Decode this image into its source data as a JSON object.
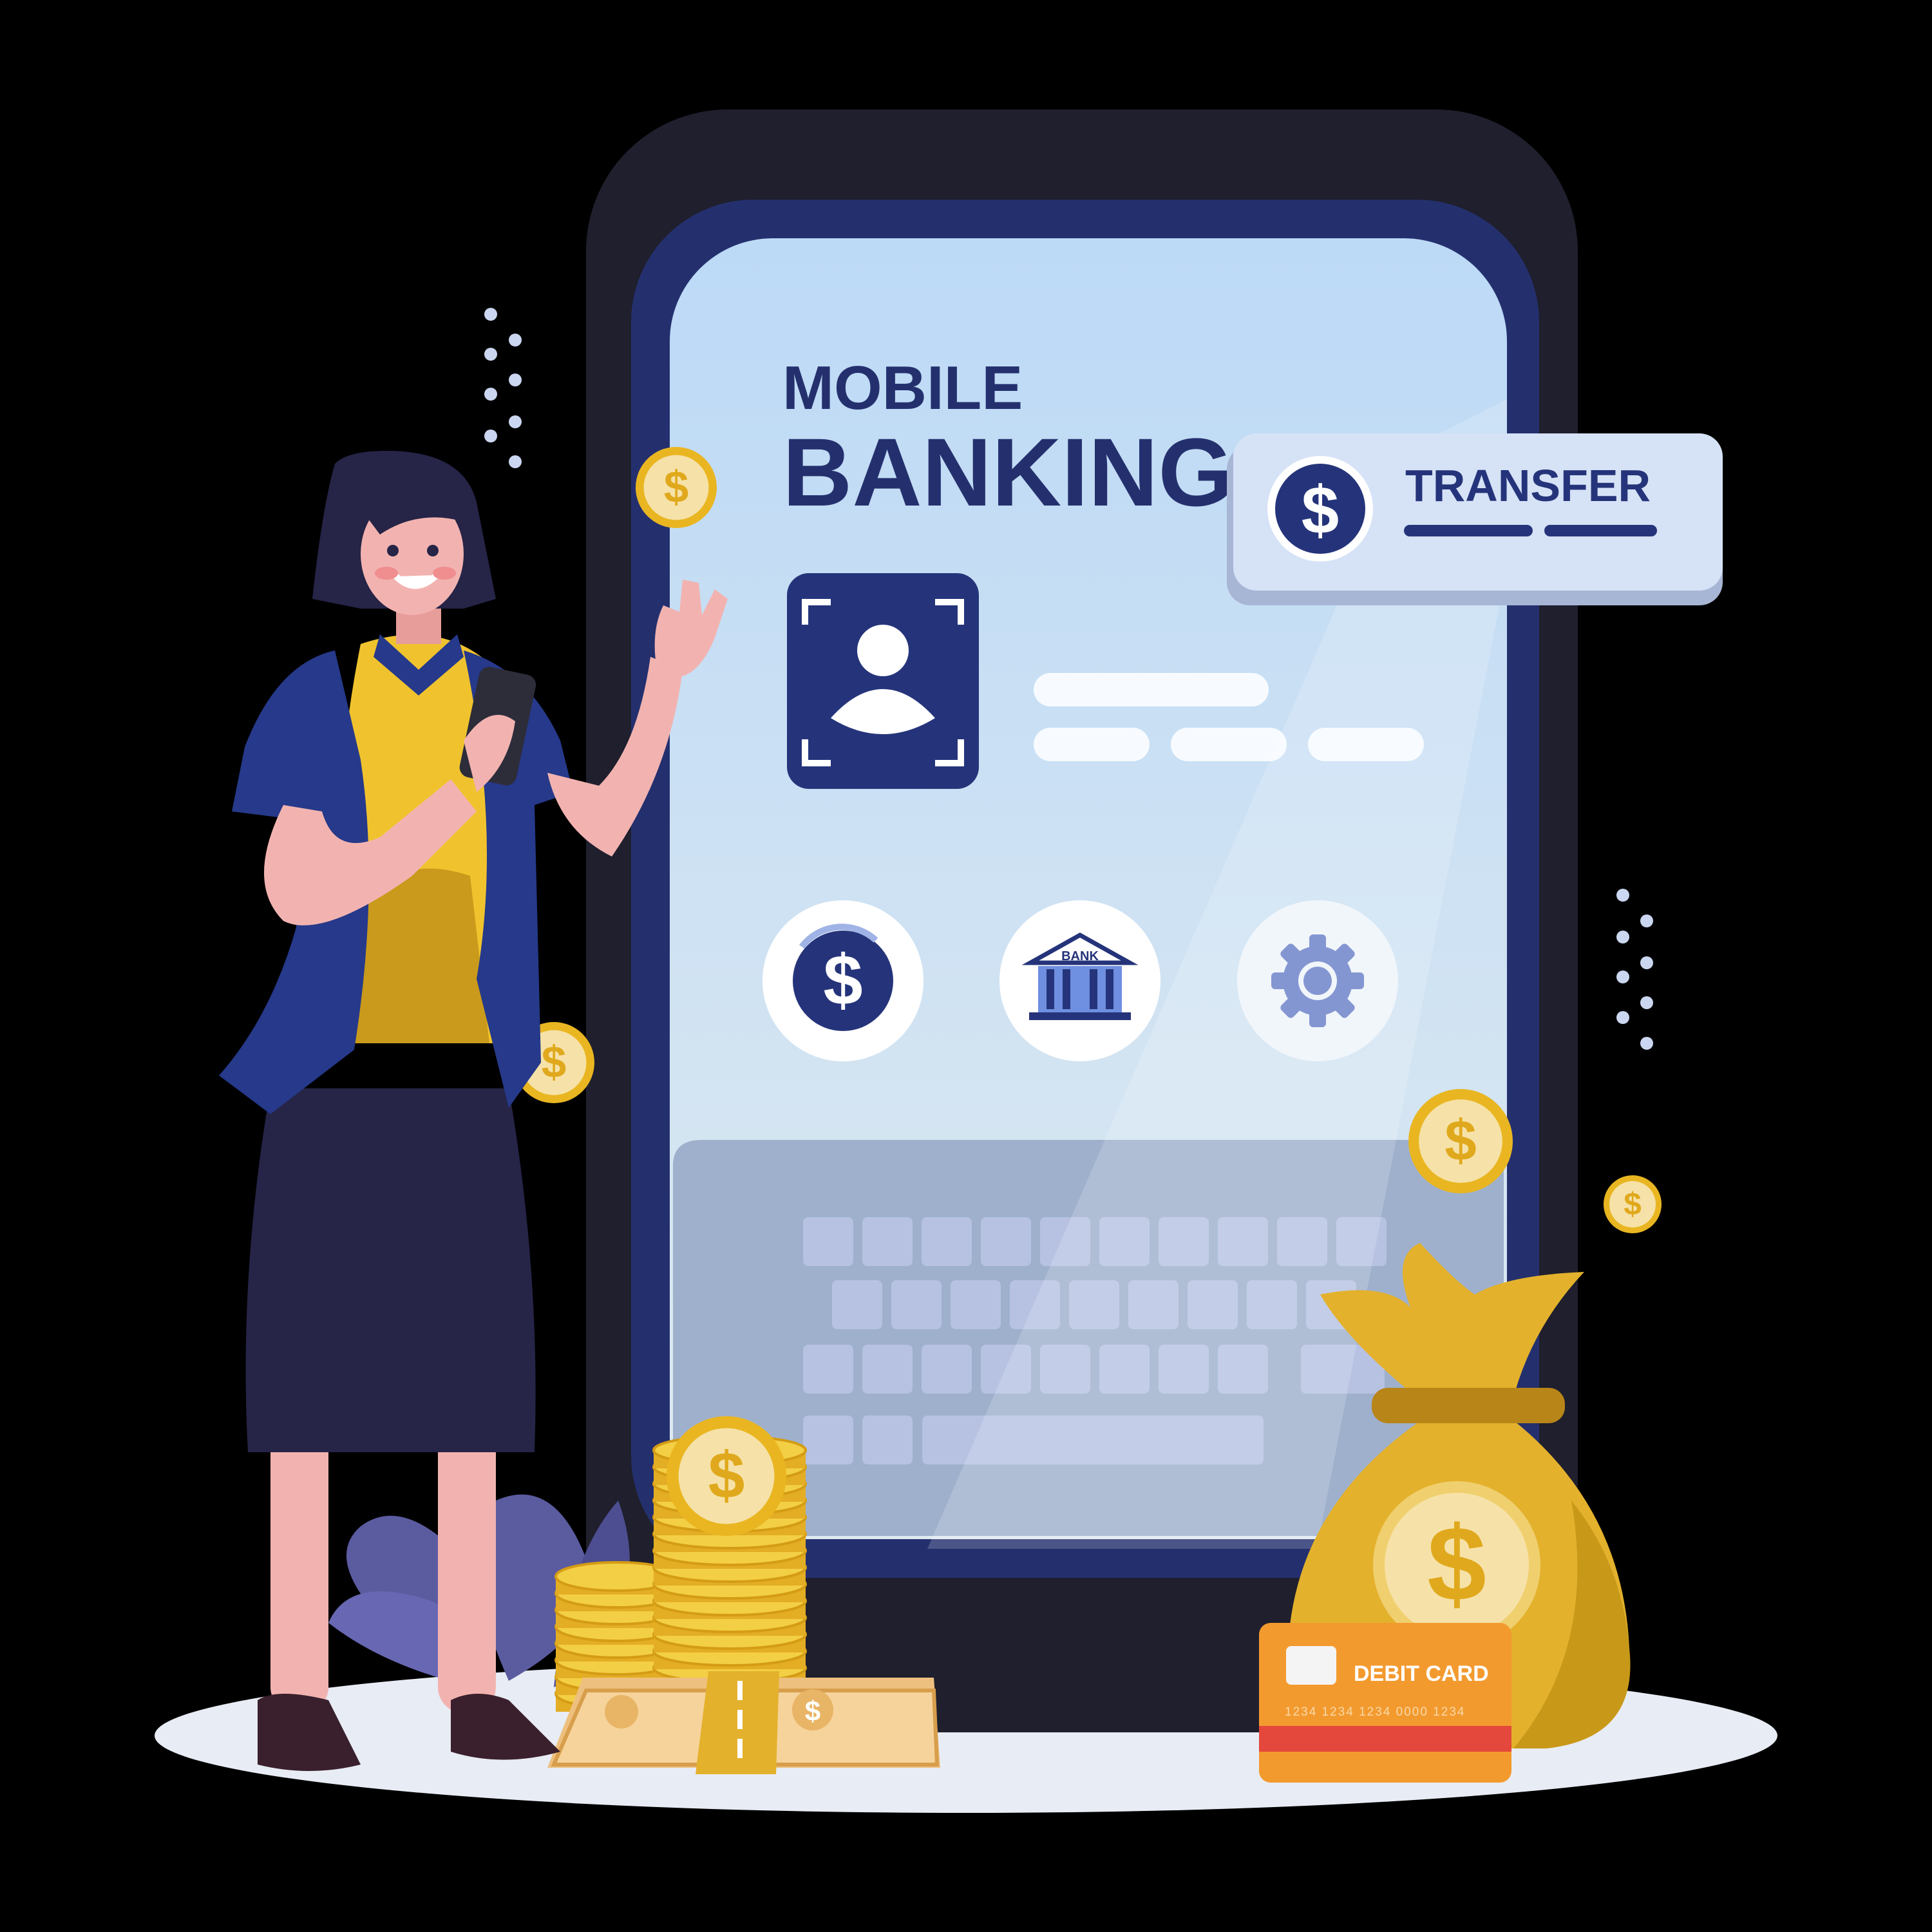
{
  "screen": {
    "title_line1": "MOBILE",
    "title_line2": "BANKING"
  },
  "transfer_card": {
    "label": "TRANSFER",
    "icon": "dollar-coin-icon"
  },
  "quick_actions": [
    {
      "name": "dollar-action-button",
      "icon": "dollar-icon"
    },
    {
      "name": "bank-action-button",
      "icon": "bank-building-icon",
      "label": "BANK"
    },
    {
      "name": "settings-action-button",
      "icon": "gear-icon"
    }
  ],
  "debit_card": {
    "label": "DEBIT CARD",
    "number": "1234 1234 1234 0000 1234"
  },
  "coin_symbol": "$",
  "colors": {
    "background": "#000000",
    "phone_body": "#1e1e2e",
    "phone_bezel": "#24306e",
    "screen": "#cfe2f3",
    "navy": "#25347a",
    "gold": "#f0c32e",
    "coin_face": "#f4e0a6",
    "card": "#f39a2f",
    "jacket": "#26398a",
    "skirt": "#262447",
    "skin": "#f2b3b0"
  }
}
